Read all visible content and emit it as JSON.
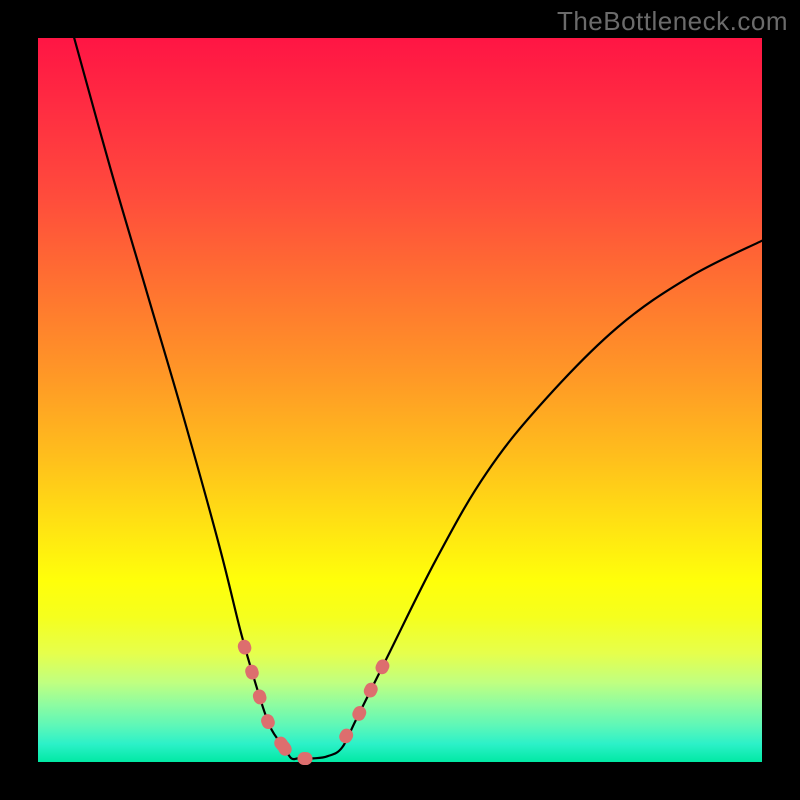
{
  "brand": "TheBottleneck.com",
  "chart_data": {
    "type": "line",
    "title": "",
    "xlabel": "",
    "ylabel": "",
    "xlim": [
      0,
      100
    ],
    "ylim": [
      0,
      100
    ],
    "series": [
      {
        "name": "curve",
        "x": [
          5,
          10,
          15,
          20,
          25,
          28,
          30,
          32,
          34,
          35,
          36,
          38,
          40,
          42,
          44,
          48,
          55,
          62,
          70,
          80,
          90,
          100
        ],
        "values": [
          100,
          82,
          65,
          48,
          30,
          18,
          11,
          5,
          2,
          0.5,
          0.5,
          0.5,
          0.8,
          2,
          6,
          14,
          28,
          40,
          50,
          60,
          67,
          72
        ]
      }
    ],
    "highlight_segments": [
      {
        "x": [
          28.5,
          30,
          32,
          34
        ],
        "y": [
          16,
          11,
          5,
          2
        ]
      },
      {
        "x": [
          34,
          35,
          36,
          38,
          40
        ],
        "y": [
          2,
          0.5,
          0.5,
          0.5,
          0.8
        ]
      },
      {
        "x": [
          42.5,
          44,
          46,
          48.5
        ],
        "y": [
          3.5,
          6,
          10,
          15
        ]
      }
    ],
    "colors": {
      "curve": "#000000",
      "highlight": "#dd6e6e"
    }
  }
}
